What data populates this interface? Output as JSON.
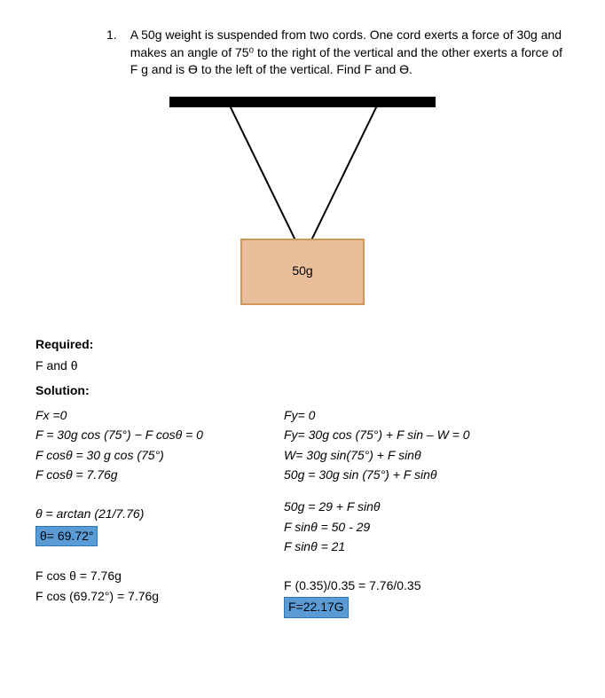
{
  "problem": {
    "number": "1.",
    "text": "A 50g weight is suspended from two cords. One cord exerts a force of 30g and makes an angle of 75⁰ to the right of the vertical and the other exerts a force of F g and is ϴ to the left of the vertical. Find F and ϴ."
  },
  "diagram": {
    "box_label": "50g"
  },
  "required": {
    "title": "Required:",
    "line1": "F and θ"
  },
  "solution": {
    "title": "Solution:",
    "left": {
      "l1": "Fx =0",
      "l2": "F = 30g cos (75°) − F cosθ = 0",
      "l3": "F cosθ = 30 g cos (75°)",
      "l4": "F cosθ = 7.76g",
      "l5": "θ = arctan (21/7.76)",
      "l6": "θ= 69.72°",
      "l7": "F cos θ = 7.76g",
      "l8": "F cos (69.72°) = 7.76g"
    },
    "right": {
      "r1": "Fy= 0",
      "r2": "Fy= 30g cos (75°) + F sin – W = 0",
      "r3": "W= 30g sin(75°) + F sinθ",
      "r4": "50g = 30g sin (75°) + F sinθ",
      "r5": "50g = 29 + F sinθ",
      "r6": "F sinθ = 50 - 29",
      "r7": "F sinθ = 21",
      "r8": "F (0.35)/0.35 = 7.76/0.35",
      "r9": "F=22.17G"
    }
  }
}
